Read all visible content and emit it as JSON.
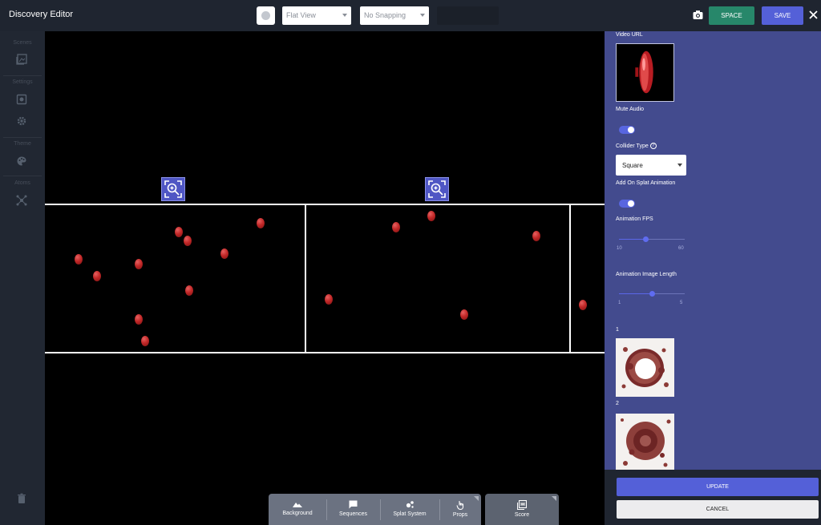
{
  "app": {
    "title": "Discovery Editor"
  },
  "toolbar": {
    "view_select": "Flat View",
    "snap_select": "No Snapping",
    "space_label": "SPACE",
    "save_label": "SAVE"
  },
  "sidebar": {
    "sections": [
      {
        "label": "Scenes",
        "icons": [
          "scenes-icon"
        ]
      },
      {
        "label": "Settings",
        "icons": [
          "settings-frame-icon",
          "gear-icon"
        ]
      },
      {
        "label": "Theme",
        "icons": [
          "palette-icon"
        ]
      },
      {
        "label": "Atoms",
        "icons": [
          "atoms-icon"
        ]
      }
    ],
    "bottom_icon": "trash-icon"
  },
  "bottom_toolbar": {
    "items": [
      {
        "label": "Background",
        "icon": "mountain-icon"
      },
      {
        "label": "Sequences",
        "icon": "chat-bubble-icon"
      },
      {
        "label": "Splat System",
        "icon": "splat-icon"
      },
      {
        "label": "Props",
        "icon": "hand-pointer-icon"
      }
    ],
    "score_label": "Score"
  },
  "properties": {
    "video_url_label": "Video URL",
    "mute_audio_label": "Mute Audio",
    "mute_audio_on": true,
    "collider_type_label": "Collider Type",
    "collider_type_value": "Square",
    "add_splat_label": "Add On Splat Animation",
    "add_splat_on": true,
    "fps_label": "Animation FPS",
    "fps_min": "10",
    "fps_max": "60",
    "fps_value_fraction": 0.4,
    "image_length_label": "Animation Image Length",
    "image_length_min": "1",
    "image_length_max": "5",
    "image_length_value_fraction": 0.5,
    "frames": [
      {
        "label": "1"
      },
      {
        "label": "2"
      }
    ],
    "update_label": "UPDATE",
    "cancel_label": "CANCEL"
  },
  "colors": {
    "topbar": "#1f2530",
    "sidebar": "#212732",
    "panel": "#434b8e",
    "accent": "#5460d8",
    "space": "#27876a",
    "balloon": "#c22828"
  }
}
